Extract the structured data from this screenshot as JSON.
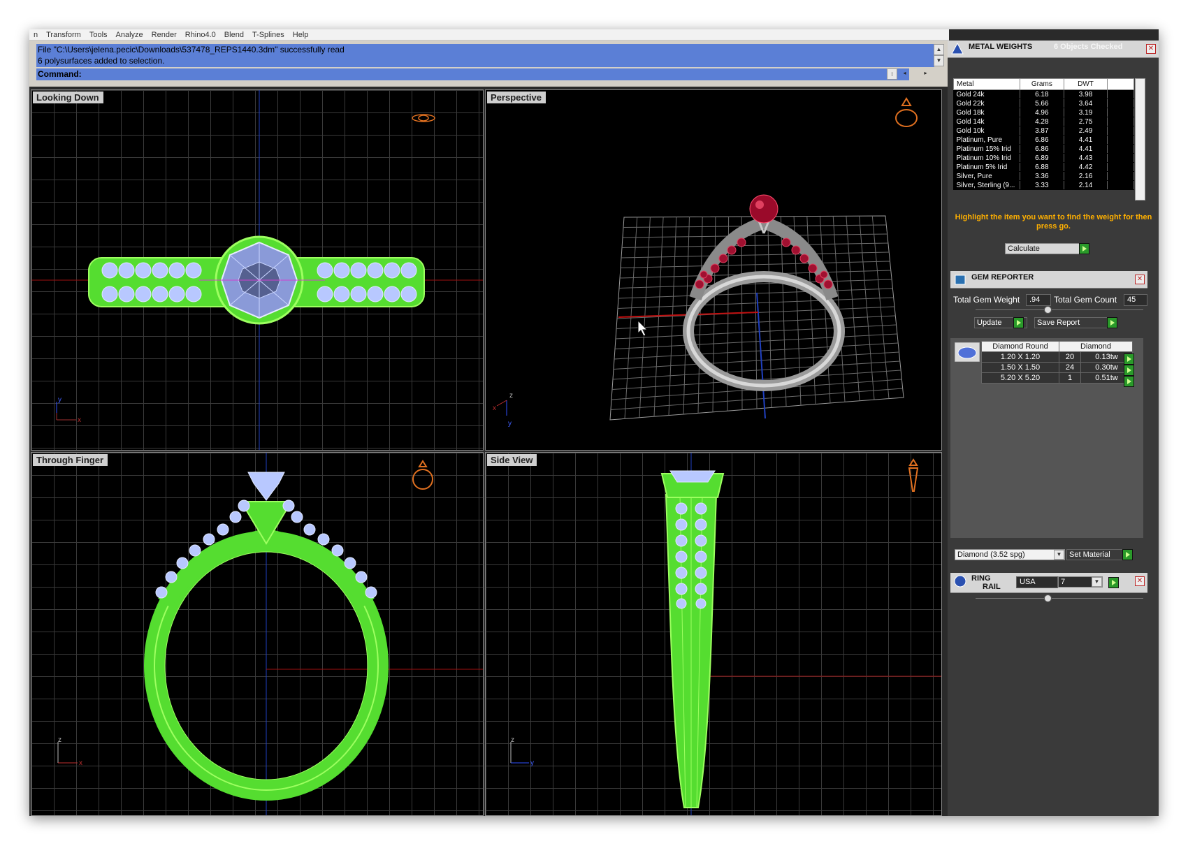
{
  "menu": [
    "n",
    "Transform",
    "Tools",
    "Analyze",
    "Render",
    "Rhino4.0",
    "Blend",
    "T-Splines",
    "Help"
  ],
  "command": {
    "history": [
      "File \"C:\\Users\\jelena.pecic\\Downloads\\537478_REPS1440.3dm\" successfully read",
      "6 polysurfaces added to selection."
    ],
    "prompt": "Command:"
  },
  "viewports": {
    "top_left": "Looking Down",
    "top_right": "Perspective",
    "bottom_left": "Through Finger",
    "bottom_right": "Side View"
  },
  "axes": {
    "x": "x",
    "y": "y",
    "z": "z"
  },
  "metal_weights": {
    "title": "METAL WEIGHTS",
    "status": "6 Objects Checked",
    "columns": [
      "Metal",
      "Grams",
      "DWT"
    ],
    "rows": [
      [
        "Gold 24k",
        "6.18",
        "3.98"
      ],
      [
        "Gold 22k",
        "5.66",
        "3.64"
      ],
      [
        "Gold 18k",
        "4.96",
        "3.19"
      ],
      [
        "Gold 14k",
        "4.28",
        "2.75"
      ],
      [
        "Gold 10k",
        "3.87",
        "2.49"
      ],
      [
        "Platinum, Pure",
        "6.86",
        "4.41"
      ],
      [
        "Platinum 15% Irid",
        "6.86",
        "4.41"
      ],
      [
        "Platinum 10% Irid",
        "6.89",
        "4.43"
      ],
      [
        "Platinum 5% Irid",
        "6.88",
        "4.42"
      ],
      [
        "Silver, Pure",
        "3.36",
        "2.16"
      ],
      [
        "Silver, Sterling (9...",
        "3.33",
        "2.14"
      ]
    ],
    "hint": "Highlight the item you want to find the weight for then press go.",
    "calculate_label": "Calculate"
  },
  "gem_reporter": {
    "title": "GEM REPORTER",
    "total_weight_label": "Total Gem Weight",
    "total_weight_value": ".94",
    "total_count_label": "Total Gem Count",
    "total_count_value": "45",
    "update_label": "Update",
    "save_report_label": "Save Report",
    "columns": [
      "Diamond Round",
      "Diamond"
    ],
    "rows": [
      [
        "1.20 X 1.20",
        "20",
        "0.13tw"
      ],
      [
        "1.50 X 1.50",
        "24",
        "0.30tw"
      ],
      [
        "5.20 X 5.20",
        "1",
        "0.51tw"
      ]
    ],
    "material_value": "Diamond    (3.52 spg)",
    "set_material_label": "Set Material"
  },
  "ring_rail": {
    "title_line1": "RING",
    "title_line2": "RAIL",
    "country": "USA",
    "size": "7"
  },
  "colors": {
    "command_bg": "#5b7fd6",
    "wire_green": "#7cff3a",
    "gem_blue": "#b8c8ff",
    "ruby": "#b0103a",
    "hint": "#ffb000"
  }
}
